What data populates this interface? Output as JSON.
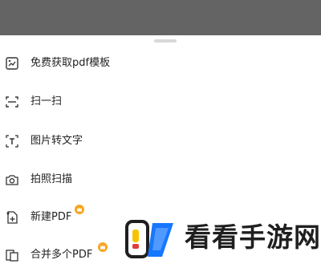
{
  "menu": {
    "items": [
      {
        "label": "免费获取pdf模板",
        "icon": "template-icon",
        "vip": false
      },
      {
        "label": "扫一扫",
        "icon": "scan-icon",
        "vip": false
      },
      {
        "label": "图片转文字",
        "icon": "image-to-text-icon",
        "vip": false
      },
      {
        "label": "拍照扫描",
        "icon": "camera-icon",
        "vip": false
      },
      {
        "label": "新建PDF",
        "icon": "new-pdf-icon",
        "vip": true
      },
      {
        "label": "合并多个PDF",
        "icon": "merge-pdf-icon",
        "vip": true
      }
    ]
  },
  "watermark": {
    "text": "看看手游网"
  },
  "colors": {
    "overlay": "#646464",
    "accent": "#f5a623",
    "logo_blue": "#1677ff"
  }
}
